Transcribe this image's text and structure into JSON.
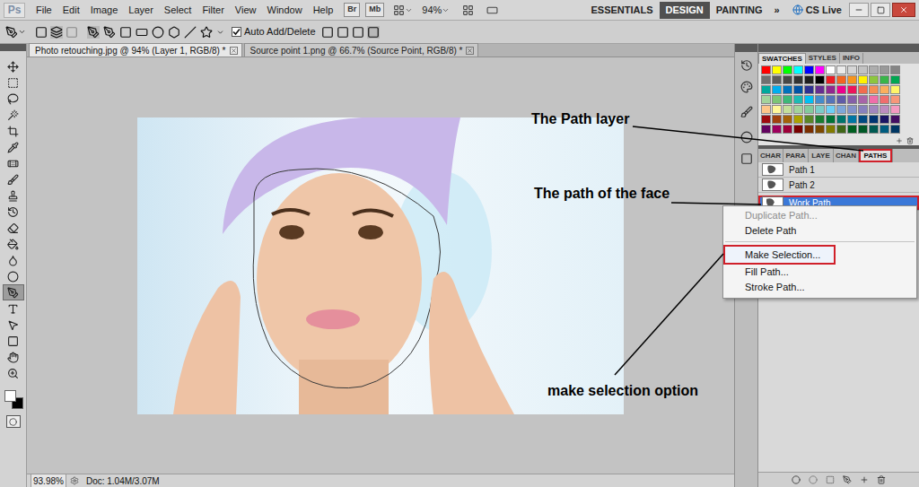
{
  "menu_bar": {
    "logo": "Ps",
    "menus": [
      "File",
      "Edit",
      "Image",
      "Layer",
      "Select",
      "Filter",
      "View",
      "Window",
      "Help"
    ],
    "bridge": "Br",
    "mini_bridge": "Mb",
    "zoom": "94%",
    "workspaces": [
      {
        "label": "ESSENTIALS",
        "selected": false
      },
      {
        "label": "DESIGN",
        "selected": true
      },
      {
        "label": "PAINTING",
        "selected": false
      }
    ],
    "more": "»",
    "cs_live": "CS Live"
  },
  "options_bar": {
    "auto_add_delete": {
      "label": "Auto Add/Delete",
      "checked": true
    }
  },
  "document_tabs": [
    {
      "label": "Photo retouching.jpg @ 94% (Layer 1, RGB/8) *",
      "selected": true
    },
    {
      "label": "Source point 1.png @ 66.7% (Source Point, RGB/8) *",
      "selected": false
    }
  ],
  "tools": [
    {
      "selected": false
    },
    {
      "selected": false
    },
    {
      "selected": false
    },
    {
      "selected": false
    },
    {
      "selected": false
    },
    {
      "selected": false
    },
    {
      "selected": false
    },
    {
      "selected": false
    },
    {
      "selected": false
    },
    {
      "selected": false
    },
    {
      "selected": false
    },
    {
      "selected": false
    },
    {
      "selected": false
    },
    {
      "selected": false
    },
    {
      "selected": true
    },
    {
      "selected": false
    },
    {
      "selected": false
    },
    {
      "selected": false
    },
    {
      "selected": false
    },
    {
      "selected": false
    }
  ],
  "canvas": {
    "annotations": [
      {
        "text": "The Path layer"
      },
      {
        "text": "The path of the face"
      },
      {
        "text": "make selection option"
      }
    ]
  },
  "status_bar": {
    "zoom": "93.98%",
    "doc": "Doc: 1.04M/3.07M"
  },
  "swatches_panel": {
    "tabs": [
      {
        "label": "SWATCHES",
        "selected": true
      },
      {
        "label": "STYLES",
        "selected": false
      },
      {
        "label": "INFO",
        "selected": false
      }
    ],
    "colors": [
      [
        "#ff0000",
        "#ffff00",
        "#00ff00",
        "#00ffff",
        "#0000ff",
        "#ff00ff",
        "#ffffff",
        "#ebebeb",
        "#d6d6d6",
        "#c2c2c2",
        "#adadad",
        "#999999",
        "#858585"
      ],
      [
        "#707070",
        "#5c5c5c",
        "#474747",
        "#333333",
        "#1f1f1f",
        "#000000",
        "#ed1c24",
        "#f26522",
        "#f7941d",
        "#fff200",
        "#8dc63f",
        "#39b54a",
        "#00a651"
      ],
      [
        "#00a99d",
        "#00aeef",
        "#0072bc",
        "#0054a6",
        "#2e3192",
        "#662d91",
        "#92278f",
        "#ec008c",
        "#ed145b",
        "#f26c4f",
        "#f68e56",
        "#fbaf5d",
        "#fff568"
      ],
      [
        "#a3d39c",
        "#7cc576",
        "#3cb878",
        "#1cbbb4",
        "#00bff3",
        "#448ccb",
        "#5674b9",
        "#605ca8",
        "#855fa8",
        "#a864a8",
        "#f06eaa",
        "#f06e6e",
        "#f7977a"
      ],
      [
        "#fdc68a",
        "#fff799",
        "#c4df9b",
        "#a3d39c",
        "#82ca9c",
        "#7accc8",
        "#6dcff6",
        "#7da7d9",
        "#8393ca",
        "#8781bd",
        "#a187be",
        "#bd8cbf",
        "#f49ac1"
      ],
      [
        "#9e0b0f",
        "#a0410d",
        "#a36209",
        "#aba000",
        "#598527",
        "#197b30",
        "#007236",
        "#00746b",
        "#0076a3",
        "#004a80",
        "#003471",
        "#1b1464",
        "#440e62"
      ],
      [
        "#630460",
        "#9e005d",
        "#9e0039",
        "#790000",
        "#7b2e00",
        "#7d4900",
        "#827b00",
        "#406618",
        "#005e20",
        "#005826",
        "#005952",
        "#005b7f",
        "#003663"
      ]
    ]
  },
  "paths_panel": {
    "tabs": [
      {
        "label": "CHAR",
        "selected": false,
        "highlighted": false
      },
      {
        "label": "PARA",
        "selected": false,
        "highlighted": false
      },
      {
        "label": "LAYE",
        "selected": false,
        "highlighted": false
      },
      {
        "label": "CHAN",
        "selected": false,
        "highlighted": false
      },
      {
        "label": "PATHS",
        "selected": true,
        "highlighted": true
      }
    ],
    "paths": [
      {
        "name": "Path 1",
        "selected": false,
        "highlighted": false
      },
      {
        "name": "Path 2",
        "selected": false,
        "highlighted": false
      },
      {
        "name": "Work Path",
        "selected": true,
        "highlighted": true
      }
    ]
  },
  "context_menu": {
    "items": [
      {
        "label": "Duplicate Path...",
        "disabled": true,
        "highlighted": false,
        "separator_before": false
      },
      {
        "label": "Delete Path",
        "disabled": false,
        "highlighted": false,
        "separator_before": false
      },
      {
        "label": "Make Selection...",
        "disabled": false,
        "highlighted": true,
        "separator_before": true
      },
      {
        "label": "Fill Path...",
        "disabled": false,
        "highlighted": false,
        "separator_before": false
      },
      {
        "label": "Stroke Path...",
        "disabled": false,
        "highlighted": false,
        "separator_before": false
      }
    ]
  }
}
